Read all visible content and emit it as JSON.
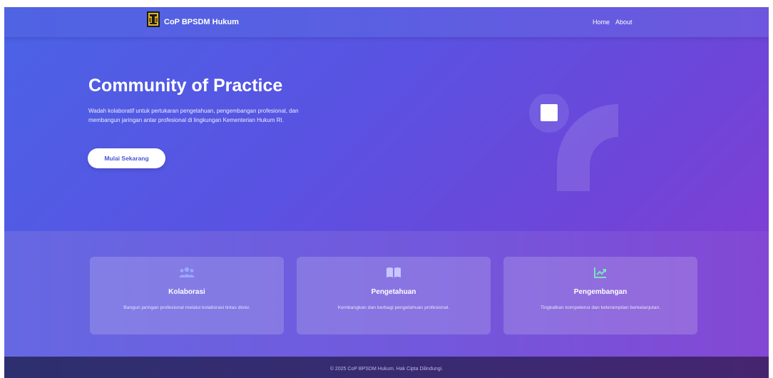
{
  "navbar": {
    "brand": "CoP BPSDM Hukum",
    "links": [
      "Home",
      "About"
    ]
  },
  "hero": {
    "title": "Community of Practice",
    "description": "Wadah kolaboratif untuk pertukaran pengetahuan, pengembangan profesional, dan membangun jaringan antar profesional di lingkungan Kementerian Hukum RI.",
    "cta_label": "Mulai Sekarang"
  },
  "features": [
    {
      "icon": "users-icon",
      "title": "Kolaborasi",
      "description": "Bangun jaringan profesional melalui kolaborasi lintas divisi."
    },
    {
      "icon": "book-open-icon",
      "title": "Pengetahuan",
      "description": "Kembangkan dan berbagi pengetahuan profesional."
    },
    {
      "icon": "chart-line-icon",
      "title": "Pengembangan",
      "description": "Tingkatkan kompetensi dan keterampilan berkelanjutan."
    }
  ],
  "footer": {
    "text": "© 2025 CoP BPSDM Hukum. Hak Cipta Dilindungi."
  },
  "colors": {
    "hero_gradient_start": "#4a63e6",
    "hero_gradient_end": "#8a3bd2",
    "icon_users": "#9aa8ff",
    "icon_book": "#c9c6ff",
    "icon_chart": "#7ee0c2",
    "footer_bg": "#2d2f6e"
  }
}
